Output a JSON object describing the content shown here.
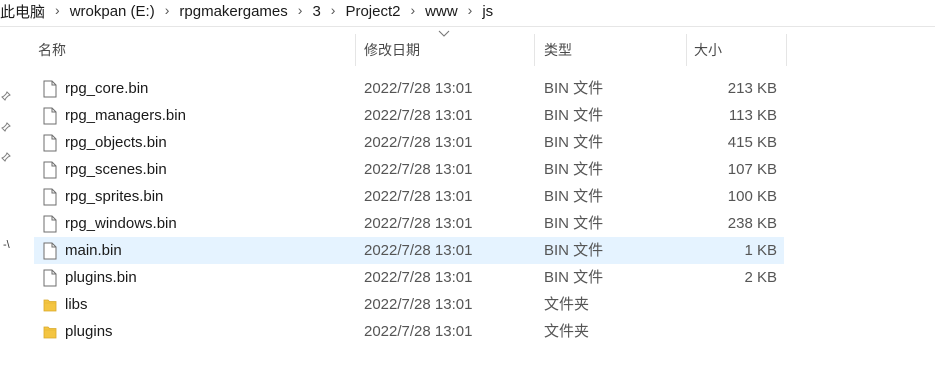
{
  "breadcrumb": {
    "items": [
      "此电脑",
      "wrokpan (E:)",
      "rpgmakergames",
      "3",
      "Project2",
      "www",
      "js"
    ]
  },
  "columns": {
    "name": "名称",
    "date": "修改日期",
    "type": "类型",
    "size": "大小"
  },
  "left_pane": {
    "fragment": "-\\"
  },
  "files": [
    {
      "name": "rpg_core.bin",
      "date": "2022/7/28 13:01",
      "type": "BIN 文件",
      "size": "213 KB",
      "kind": "file"
    },
    {
      "name": "rpg_managers.bin",
      "date": "2022/7/28 13:01",
      "type": "BIN 文件",
      "size": "113 KB",
      "kind": "file"
    },
    {
      "name": "rpg_objects.bin",
      "date": "2022/7/28 13:01",
      "type": "BIN 文件",
      "size": "415 KB",
      "kind": "file"
    },
    {
      "name": "rpg_scenes.bin",
      "date": "2022/7/28 13:01",
      "type": "BIN 文件",
      "size": "107 KB",
      "kind": "file"
    },
    {
      "name": "rpg_sprites.bin",
      "date": "2022/7/28 13:01",
      "type": "BIN 文件",
      "size": "100 KB",
      "kind": "file"
    },
    {
      "name": "rpg_windows.bin",
      "date": "2022/7/28 13:01",
      "type": "BIN 文件",
      "size": "238 KB",
      "kind": "file"
    },
    {
      "name": "main.bin",
      "date": "2022/7/28 13:01",
      "type": "BIN 文件",
      "size": "1 KB",
      "kind": "file",
      "selected": true
    },
    {
      "name": "plugins.bin",
      "date": "2022/7/28 13:01",
      "type": "BIN 文件",
      "size": "2 KB",
      "kind": "file"
    },
    {
      "name": "libs",
      "date": "2022/7/28 13:01",
      "type": "文件夹",
      "size": "",
      "kind": "folder"
    },
    {
      "name": "plugins",
      "date": "2022/7/28 13:01",
      "type": "文件夹",
      "size": "",
      "kind": "folder"
    }
  ],
  "colors": {
    "selected_row": "#e5f3ff",
    "folder": "#f4c542"
  },
  "icons": {
    "file": "file-icon",
    "folder": "folder-icon",
    "pin": "pin-icon",
    "sort": "sort-descending-icon"
  }
}
